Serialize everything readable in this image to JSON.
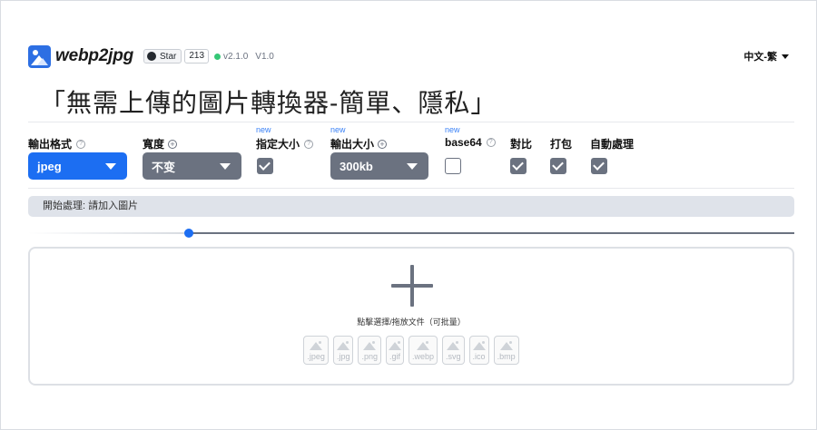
{
  "header": {
    "app_name": "webp2jpg",
    "github_star_label": "Star",
    "github_star_count": "213",
    "version": "v2.1.0",
    "version_secondary": "V1.0",
    "language": "中文-繁"
  },
  "title": "「無需上傳的圖片轉換器-簡單、隱私」",
  "options": {
    "format": {
      "label": "輸出格式",
      "value": "jpeg"
    },
    "width": {
      "label": "寬度",
      "value": "不变"
    },
    "specify_size": {
      "new": "new",
      "label": "指定大小",
      "checked": true
    },
    "output_size": {
      "new": "new",
      "label": "輸出大小",
      "value": "300kb"
    },
    "base64": {
      "new": "new",
      "label": "base64",
      "checked": false
    },
    "compare": {
      "label": "對比",
      "checked": true
    },
    "pack": {
      "label": "打包",
      "checked": true
    },
    "auto_process": {
      "label": "自動處理",
      "checked": true
    }
  },
  "status_text": "開始處理: 請加入圖片",
  "slider": {
    "value": 0.21
  },
  "dropzone": {
    "text": "點擊選擇/拖放文件（可批量）",
    "formats": [
      ".jpeg",
      ".jpg",
      ".png",
      ".gif",
      ".webp",
      ".svg",
      ".ico",
      ".bmp"
    ]
  },
  "colors": {
    "accent": "#1c6ef2",
    "control_gray": "#6b7280",
    "status_bg": "#dfe3ea",
    "online_dot": "#35c776"
  }
}
